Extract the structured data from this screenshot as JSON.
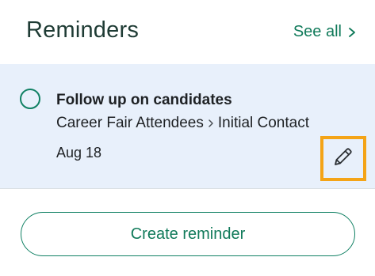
{
  "header": {
    "title": "Reminders",
    "see_all_label": "See all",
    "see_all_icon": "chevron-right-icon"
  },
  "reminder": {
    "title": "Follow up on candidates",
    "breadcrumb": [
      "Career Fair Attendees",
      "Initial Contact"
    ],
    "breadcrumb_separator_icon": "chevron-right-icon",
    "due_date": "Aug 18",
    "edit_icon": "pencil-icon",
    "completed": false
  },
  "create_button": {
    "label": "Create reminder"
  },
  "colors": {
    "accent": "#107a5a",
    "card_background": "#e8f0fb",
    "highlight": "#f4a417",
    "title_text": "#1e3b34"
  }
}
